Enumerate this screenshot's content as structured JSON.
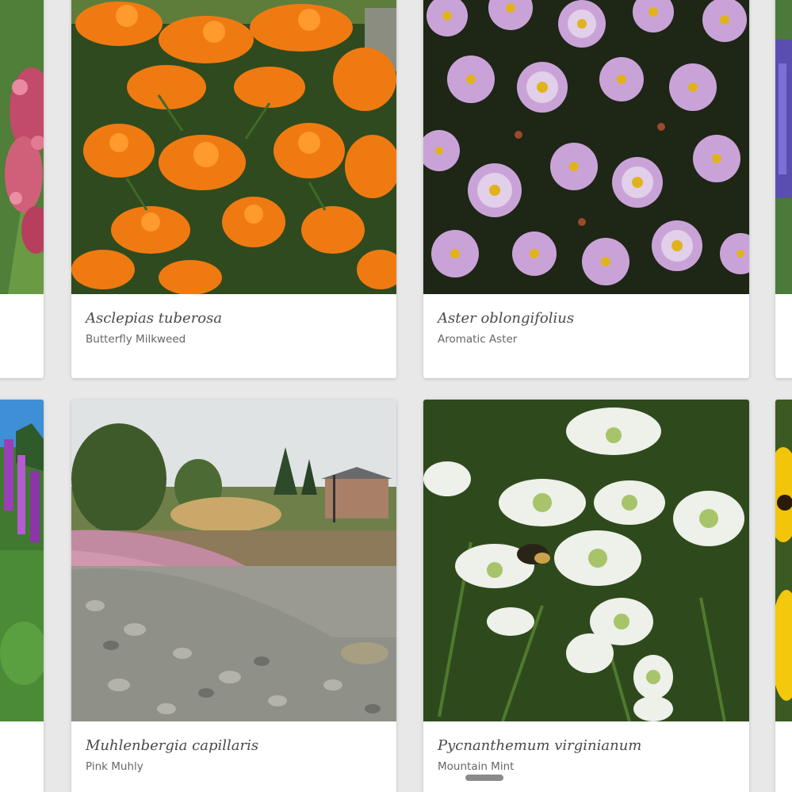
{
  "plants": [
    {
      "scientific_name": "Asclepias tuberosa",
      "common_name": "Butterfly Milkweed"
    },
    {
      "scientific_name": "Aster oblongifolius",
      "common_name": "Aromatic Aster"
    },
    {
      "scientific_name": "Muhlenbergia capillaris",
      "common_name": "Pink Muhly"
    },
    {
      "scientific_name": "Pycnanthemum virginianum",
      "common_name": "Mountain Mint"
    }
  ],
  "colors": {
    "page_background": "#e8e8e8",
    "card_background": "#ffffff",
    "scientific_name": "#4a4a4a",
    "common_name": "#666666"
  }
}
